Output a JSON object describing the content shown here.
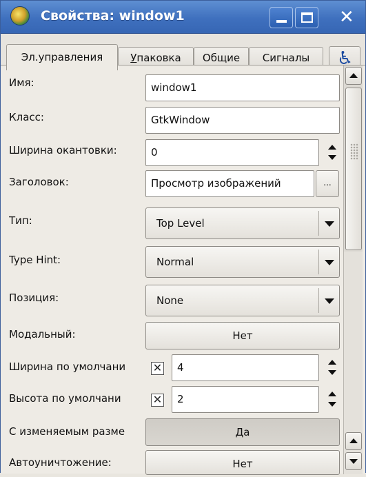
{
  "window": {
    "title": "Свойства: window1",
    "icon": "glade-app-icon",
    "controls": [
      "minimize-icon",
      "maximize-icon",
      "close-icon"
    ]
  },
  "tabs": [
    {
      "label": "Эл.управления",
      "active": true
    },
    {
      "label_prefix": "У",
      "label_rest": "паковка",
      "active": false
    },
    {
      "label": "Общие",
      "active": false
    },
    {
      "label": "Сигналы",
      "active": false
    }
  ],
  "accessibility_tab": {
    "icon": "accessibility-icon"
  },
  "properties": {
    "name": {
      "label": "Имя:",
      "value": "window1"
    },
    "class": {
      "label": "Класс:",
      "value": "GtkWindow"
    },
    "border_width": {
      "label": "Ширина окантовки:",
      "value": "0"
    },
    "title": {
      "label": "Заголовок:",
      "value": "Просмотр изображений",
      "button": "..."
    },
    "type": {
      "label": "Тип:",
      "value": "Top Level"
    },
    "type_hint": {
      "label": "Type Hint:",
      "value": "Normal"
    },
    "position": {
      "label": "Позиция:",
      "value": "None"
    },
    "modal": {
      "label": "Модальный:",
      "value": "Нет"
    },
    "default_width": {
      "label": "Ширина по умолчани",
      "checkbox": "✕",
      "value": "4"
    },
    "default_height": {
      "label": "Высота по умолчани",
      "checkbox": "✕",
      "value": "2"
    },
    "resizable": {
      "label": "С изменяемым разме",
      "value": "Да"
    },
    "destroy_with_parent": {
      "label": "Автоуничтожение:",
      "value": "Нет"
    }
  }
}
